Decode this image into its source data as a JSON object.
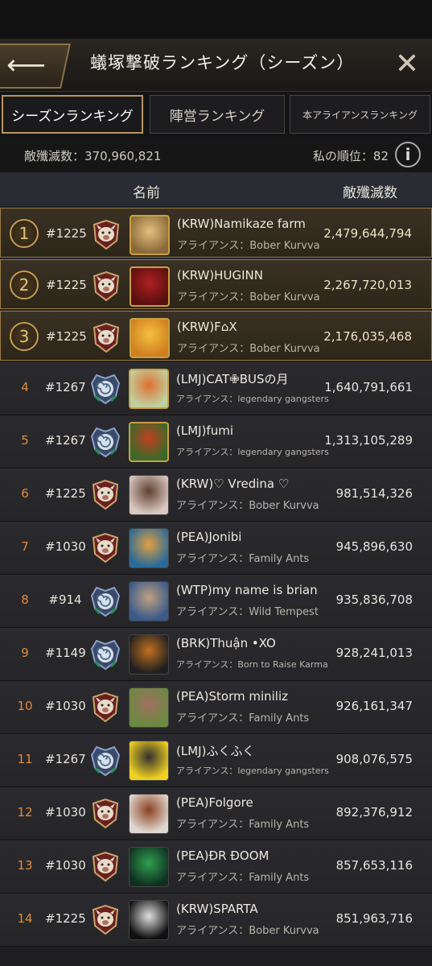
{
  "header": {
    "title": "蟻塚撃破ランキング（シーズン）",
    "back_icon": "back-arrow-icon",
    "close_icon": "close-icon"
  },
  "tabs": [
    {
      "label": "シーズンランキング",
      "active": true
    },
    {
      "label": "陣営ランキング",
      "active": false
    },
    {
      "label": "本アライアンスランキング",
      "active": false
    }
  ],
  "stats": {
    "kills_text": "敵殲滅数：370,960,821",
    "my_rank_text": "私の順位：82",
    "info_icon": "info-icon"
  },
  "columns": {
    "name": "名前",
    "kills": "敵殲滅数"
  },
  "rows": [
    {
      "rank": "1",
      "colony": "#1225",
      "faction": "boar",
      "name": "(KRW)Namikaze farm",
      "alliance": "アライアンス：Bober Kurvva",
      "score": "2,479,644,794",
      "top": true
    },
    {
      "rank": "2",
      "colony": "#1225",
      "faction": "boar",
      "name": "(KRW)HUGINN",
      "alliance": "アライアンス：Bober Kurvva",
      "score": "2,267,720,013",
      "top": true
    },
    {
      "rank": "3",
      "colony": "#1225",
      "faction": "boar",
      "name": "(KRW)F⌂X",
      "alliance": "アライアンス：Bober Kurvva",
      "score": "2,176,035,468",
      "top": true
    },
    {
      "rank": "4",
      "colony": "#1267",
      "faction": "spiral",
      "name": "(LMJ)CAT✙BUSの月",
      "alliance": "アライアンス：legendary gangsters",
      "score": "1,640,791,661",
      "top": false,
      "small": true
    },
    {
      "rank": "5",
      "colony": "#1267",
      "faction": "spiral",
      "name": "(LMJ)fumi",
      "alliance": "アライアンス：legendary gangsters",
      "score": "1,313,105,289",
      "top": false,
      "small": true
    },
    {
      "rank": "6",
      "colony": "#1225",
      "faction": "boar",
      "name": "(KRW)♡ Vredina ♡",
      "alliance": "アライアンス：Bober Kurvva",
      "score": "981,514,326",
      "top": false
    },
    {
      "rank": "7",
      "colony": "#1030",
      "faction": "boar",
      "name": "(PEA)Jonibi",
      "alliance": "アライアンス：Family Ants",
      "score": "945,896,630",
      "top": false
    },
    {
      "rank": "8",
      "colony": "#914",
      "faction": "spiral",
      "name": "(WTP)my name is brian",
      "alliance": "アライアンス：Wild Tempest",
      "score": "935,836,708",
      "top": false
    },
    {
      "rank": "9",
      "colony": "#1149",
      "faction": "spiral",
      "name": "(BRK)Thuận •XO",
      "alliance": "アライアンス：Born to Raise Karma",
      "score": "928,241,013",
      "top": false,
      "small": true
    },
    {
      "rank": "10",
      "colony": "#1030",
      "faction": "boar",
      "name": "(PEA)Storm miniliz",
      "alliance": "アライアンス：Family Ants",
      "score": "926,161,347",
      "top": false
    },
    {
      "rank": "11",
      "colony": "#1267",
      "faction": "spiral",
      "name": "(LMJ)ふくふく",
      "alliance": "アライアンス：legendary gangsters",
      "score": "908,076,575",
      "top": false,
      "small": true
    },
    {
      "rank": "12",
      "colony": "#1030",
      "faction": "boar",
      "name": "(PEA)Folgore",
      "alliance": "アライアンス：Family Ants",
      "score": "892,376,912",
      "top": false
    },
    {
      "rank": "13",
      "colony": "#1030",
      "faction": "boar",
      "name": "(PEA)ĐR ĐOOM",
      "alliance": "アライアンス：Family Ants",
      "score": "857,653,116",
      "top": false
    },
    {
      "rank": "14",
      "colony": "#1225",
      "faction": "boar",
      "name": "(KRW)SPARTA",
      "alliance": "アライアンス：Bober Kurvva",
      "score": "851,963,716",
      "top": false
    }
  ],
  "colors": {
    "accent_gold": "#b8955c",
    "rank_orange": "#e08a3c",
    "header_bar": "#2a2c34"
  }
}
